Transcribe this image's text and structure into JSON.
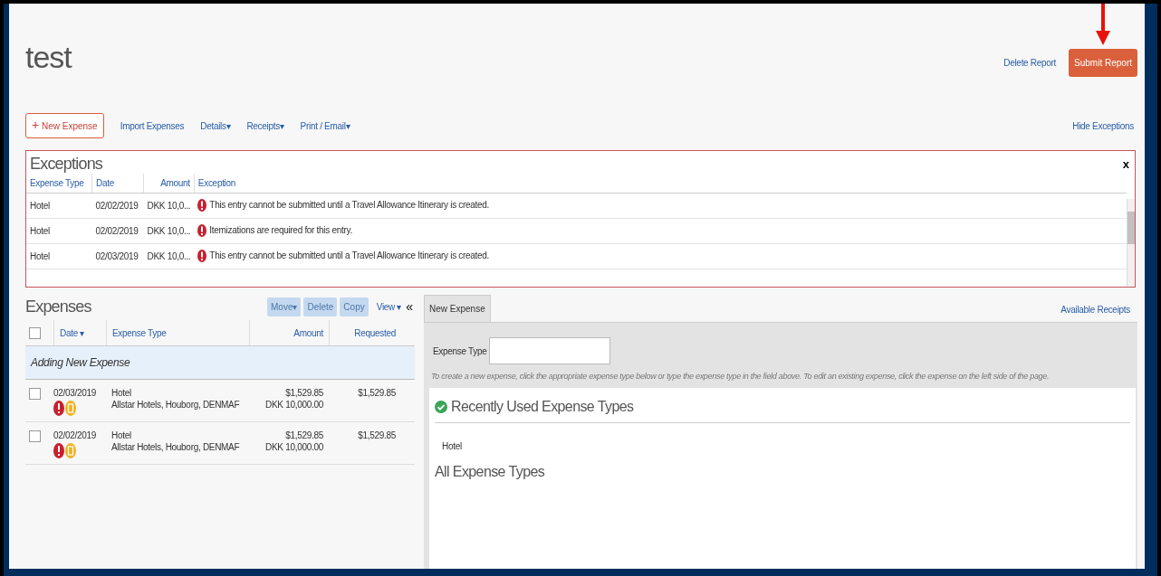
{
  "report": {
    "title": "test",
    "delete_label": "Delete Report",
    "submit_label": "Submit Report"
  },
  "toolbar": {
    "new_expense": {
      "icon": "+",
      "label": "New Expense"
    },
    "links": [
      {
        "label": "Import Expenses"
      },
      {
        "label": "Details",
        "caret": "▾"
      },
      {
        "label": "Receipts",
        "caret": "▾"
      },
      {
        "label": "Print / Email",
        "caret": "▾"
      }
    ],
    "hide_exceptions": "Hide Exceptions"
  },
  "exceptions": {
    "title": "Exceptions",
    "close": "x",
    "columns": [
      "Expense Type",
      "Date",
      "Amount",
      "Exception"
    ],
    "rows": [
      {
        "expense_type": "Hotel",
        "date": "02/02/2019",
        "amount": "DKK 10,0...",
        "exception": "This entry cannot be submitted until a Travel Allowance Itinerary is created."
      },
      {
        "expense_type": "Hotel",
        "date": "02/02/2019",
        "amount": "DKK 10,0...",
        "exception": "Itemizations are required for this entry."
      },
      {
        "expense_type": "Hotel",
        "date": "02/03/2019",
        "amount": "DKK 10,0...",
        "exception": "This entry cannot be submitted until a Travel Allowance Itinerary is created."
      }
    ]
  },
  "expenses": {
    "title": "Expenses",
    "actions": [
      {
        "label": "Move",
        "caret": "▾",
        "disabled": true
      },
      {
        "label": "Delete",
        "disabled": true
      },
      {
        "label": "Copy",
        "disabled": true
      }
    ],
    "view": "View",
    "view_caret": "▾",
    "collapse": "«",
    "select_all_checked": false,
    "columns": [
      {
        "label": "Date",
        "caret": "▾"
      },
      {
        "label": "Expense Type"
      },
      {
        "label": "Amount"
      },
      {
        "label": "Requested"
      }
    ],
    "adding": "Adding New Expense",
    "rows": [
      {
        "checked": false,
        "date": "02/03/2019",
        "type": "Hotel",
        "vendor": "Allstar Hotels, Houborg, DENMAF",
        "amount": "$1,529.85",
        "amount_foreign": "DKK 10,000.00",
        "requested": "$1,529.85"
      },
      {
        "checked": false,
        "date": "02/02/2019",
        "type": "Hotel",
        "vendor": "Allstar Hotels, Houborg, DENMAF",
        "amount": "$1,529.85",
        "amount_foreign": "DKK 10,000.00",
        "requested": "$1,529.85"
      }
    ]
  },
  "detail": {
    "tabs": [
      {
        "label": "New Expense",
        "selected": true
      }
    ],
    "available_receipts": "Available Receipts",
    "field_label": "Expense Type",
    "hint": "To create a new expense, click the appropriate expense type below or type the expense type in the field above. To edit an existing expense, click the expense on the left side of the page.",
    "recent_title": "Recently Used Expense Types",
    "recent": [
      "Hotel"
    ],
    "all_title": "All Expense Types"
  }
}
